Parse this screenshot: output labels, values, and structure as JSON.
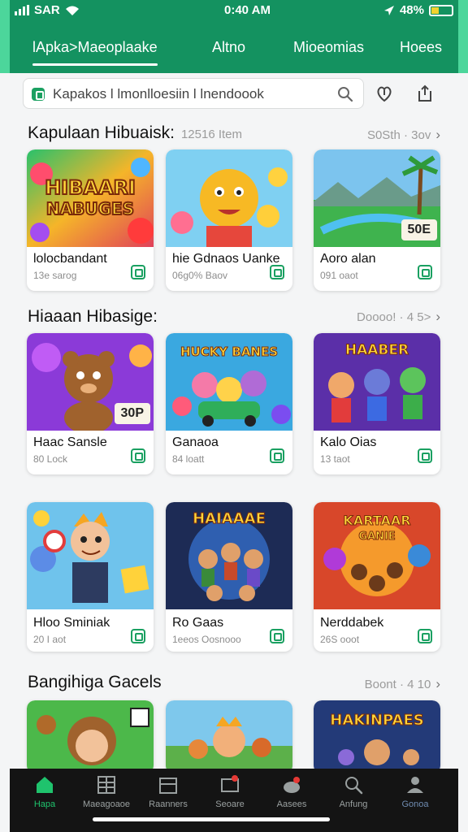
{
  "status_bar": {
    "carrier": "SAR",
    "time": "0:40 AM",
    "battery": "48%"
  },
  "tabs": [
    {
      "label": "lApka>Maeoplaake",
      "active": true
    },
    {
      "label": "Altno",
      "active": false
    },
    {
      "label": "Mioeomias",
      "active": false
    },
    {
      "label": "Hoees",
      "active": false
    }
  ],
  "search": {
    "value": "Kapakos l lmonlloesiin l lnendoook"
  },
  "sections": [
    {
      "title": "Kapulaan Hibuaisk:",
      "meta": "12516 Item",
      "more": "S0Sth · 3ov",
      "cards": [
        {
          "name": "lolocbandant",
          "sub": "13e sarog",
          "art_text": "HIBAARI NABUGES"
        },
        {
          "name": "hie Gdnaos Uanke",
          "sub": "06g0% Baov",
          "art_text": ""
        },
        {
          "name": "Aoro alan",
          "sub": "091 oaot",
          "art_text": "",
          "badge": "50E"
        }
      ]
    },
    {
      "title": "Hiaaan Hibasige:",
      "meta": "",
      "more": "Doooo! · 4 5>",
      "cards": [
        {
          "name": "Haac Sansle",
          "sub": "80 Lock",
          "art_text": "",
          "badge": "30P"
        },
        {
          "name": "Ganaoa",
          "sub": "84 loatt",
          "art_text": "HUCKY BANES"
        },
        {
          "name": "Kalo Oias",
          "sub": "13 taot",
          "art_text": "HAABER"
        }
      ]
    },
    {
      "title": "",
      "meta": "",
      "more": "",
      "cards": [
        {
          "name": "Hloo Sminiak",
          "sub": "20 I aot",
          "art_text": ""
        },
        {
          "name": "Ro Gaas",
          "sub": "1eeos Oosnooo",
          "art_text": "HAIAAAE"
        },
        {
          "name": "Nerddabek",
          "sub": "26S ooot",
          "art_text": "KARTAAR GANIE"
        }
      ]
    },
    {
      "title": "Bangihiga Gacels",
      "meta": "",
      "more": "Boont · 4 10",
      "cards": [
        {
          "name": "",
          "sub": "",
          "art_text": ""
        },
        {
          "name": "",
          "sub": "",
          "art_text": ""
        },
        {
          "name": "",
          "sub": "",
          "art_text": "HAKINPAES"
        }
      ]
    }
  ],
  "bottom_nav": [
    {
      "label": "Hapa",
      "icon": "home-icon",
      "active": true
    },
    {
      "label": "Maeagoaoe",
      "icon": "grid-icon",
      "active": false
    },
    {
      "label": "Raanners",
      "icon": "calendar-icon",
      "active": false
    },
    {
      "label": "Seoare",
      "icon": "tv-icon",
      "active": false
    },
    {
      "label": "Aasees",
      "icon": "cloud-icon",
      "active": false
    },
    {
      "label": "Anfung",
      "icon": "search-icon",
      "active": false
    },
    {
      "label": "Gonoa",
      "icon": "user-icon",
      "active": false
    }
  ],
  "colors": {
    "brand": "#149260",
    "accent": "#1aa061",
    "nav_active": "#1fc36d"
  }
}
